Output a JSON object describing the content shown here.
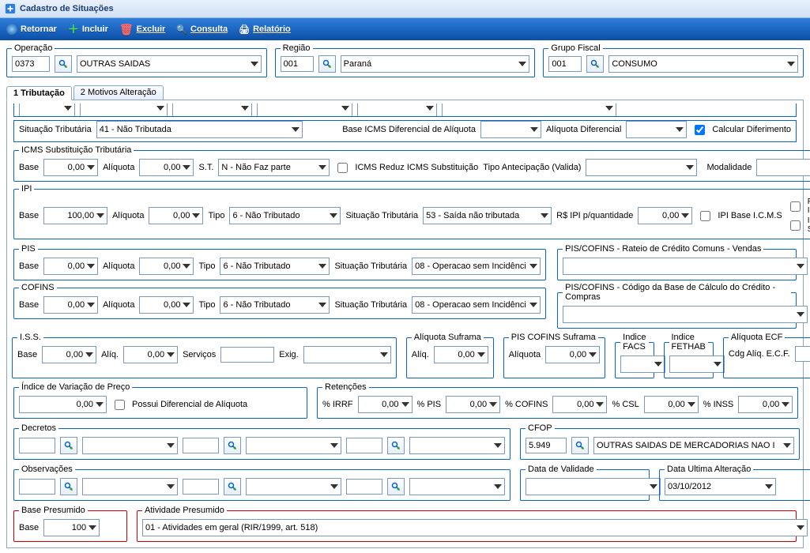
{
  "window": {
    "title": "Cadastro de Situações"
  },
  "toolbar": {
    "retornar": "Retornar",
    "incluir": "Incluir",
    "excluir": "Excluir",
    "consulta": "Consulta",
    "relatorio": "Relatório"
  },
  "top": {
    "operacao": {
      "legend": "Operação",
      "code": "0373",
      "desc": "OUTRAS SAIDAS"
    },
    "regiao": {
      "legend": "Região",
      "code": "001",
      "desc": "Paraná"
    },
    "grupo": {
      "legend": "Grupo Fiscal",
      "code": "001",
      "desc": "CONSUMO"
    }
  },
  "tabs": {
    "t1": "1 Tributação",
    "t2": "2 Motivos Alteração"
  },
  "line1": {
    "sit_trib_lbl": "Situação Tributária",
    "sit_trib_val": "41 - Não Tributada",
    "base_icms_dif_lbl": "Base ICMS Diferencial de Alíquota",
    "aliq_dif_lbl": "Alíquota Diferencial",
    "calc_dif": "Calcular Diferimento"
  },
  "icms_sub": {
    "legend": "ICMS Substituição Tributária",
    "base_lbl": "Base",
    "base_val": "0,00",
    "aliq_lbl": "Alíquota",
    "aliq_val": "0,00",
    "st_lbl": "S.T.",
    "st_val": "N - Não Faz parte",
    "chk_reduz": "ICMS Reduz ICMS Substituição",
    "tipo_antecip_lbl": "Tipo Antecipação (Valida)",
    "modalidade_lbl": "Modalidade"
  },
  "ipi": {
    "legend": "IPI",
    "base_lbl": "Base",
    "base_val": "100,00",
    "aliq_lbl": "Alíquota",
    "aliq_val": "0,00",
    "tipo_lbl": "Tipo",
    "tipo_val": "6 - Não Tributado",
    "sit_lbl": "Situação Tributária",
    "sit_val": "53 - Saída não tributada",
    "rsipi_lbl": "R$ IPI p/quantidade",
    "rsipi_val": "0,00",
    "chk_baseicms": "IPI Base I.C.M.S",
    "chk_frete": "Frete Base do IPI",
    "chk_basesub": "IPI Base Substituição"
  },
  "pis": {
    "legend": "PIS",
    "base_lbl": "Base",
    "base_val": "0,00",
    "aliq_lbl": "Alíquota",
    "aliq_val": "0,00",
    "tipo_lbl": "Tipo",
    "tipo_val": "6 - Não Tributado",
    "sit_lbl": "Situação Tributária",
    "sit_val": "08 - Operacao sem Incidênci"
  },
  "cofins": {
    "legend": "COFINS",
    "base_lbl": "Base",
    "base_val": "0,00",
    "aliq_lbl": "Alíquota",
    "aliq_val": "0,00",
    "tipo_lbl": "Tipo",
    "tipo_val": "6 - Não Tributado",
    "sit_lbl": "Situação Tributária",
    "sit_val": "08 - Operacao sem Incidênci"
  },
  "piscofins_vend": {
    "legend": "PIS/COFINS - Rateio de Crédito Comuns - Vendas"
  },
  "piscofins_comp": {
    "legend": "PIS/COFINS - Código da Base de Cálculo do Crédito - Compras"
  },
  "iss": {
    "legend": "I.S.S.",
    "base_lbl": "Base",
    "base_val": "0,00",
    "aliq_lbl": "Alíq.",
    "aliq_val": "0,00",
    "servicos_lbl": "Serviços",
    "exig_lbl": "Exig."
  },
  "aliq_suframa": {
    "legend": "Alíquota Suframa",
    "lbl": "Alíq.",
    "val": "0,00"
  },
  "pis_cofins_suframa": {
    "legend": "PIS COFINS Suframa",
    "lbl": "Alíquota",
    "val": "0,00"
  },
  "indice_facs": {
    "legend": "Indice FACS"
  },
  "indice_fethab": {
    "legend": "Indice FETHAB"
  },
  "aliq_ecf": {
    "legend": "Alíquota ECF",
    "lbl": "Cdg Alíq. E.C.F."
  },
  "indvar": {
    "legend": "Índice de Variação de Preço",
    "val": "0,00",
    "possui": "Possui Diferencial de Alíquota"
  },
  "retenc": {
    "legend": "Retenções",
    "pirrf": "% IRRF",
    "pirrf_val": "0,00",
    "ppis": "% PIS",
    "ppis_val": "0,00",
    "pcofins": "% COFINS",
    "pcofins_val": "0,00",
    "pcsl": "% CSL",
    "pcsl_val": "0,00",
    "pinss": "% INSS",
    "pinss_val": "0,00"
  },
  "decretos": {
    "legend": "Decretos"
  },
  "cfop": {
    "legend": "CFOP",
    "code": "5.949",
    "desc": "OUTRAS SAIDAS DE MERCADORIAS NAO I"
  },
  "observ": {
    "legend": "Observações"
  },
  "datavalid": {
    "legend": "Data de Validade"
  },
  "dataalt": {
    "legend": "Data Ultima Alteração",
    "val": "03/10/2012"
  },
  "basepres": {
    "legend": "Base Presumido",
    "lbl": "Base",
    "val": "100"
  },
  "ativpres": {
    "legend": "Atividade Presumido",
    "val": "01 - Atividades em geral (RIR/1999, art. 518)"
  }
}
